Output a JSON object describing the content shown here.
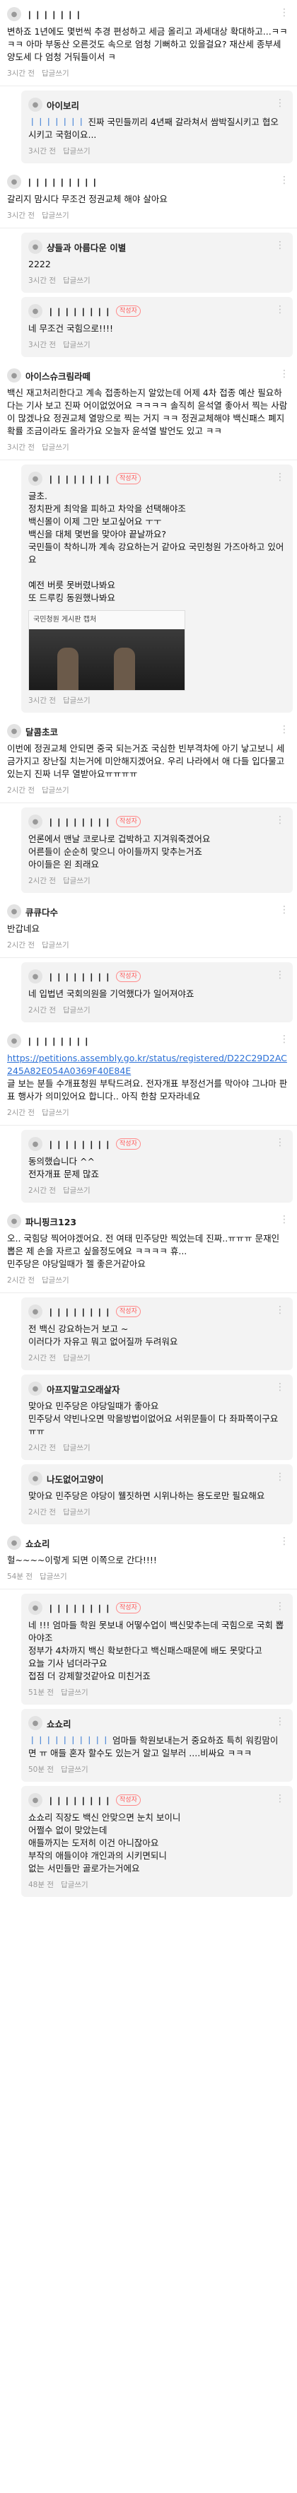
{
  "comments": [
    {
      "name": "ㅣㅣㅣㅣㅣㅣㅣ",
      "body": "변하죠 1년에도 몇번씩 추경 편성하고 세금 올리고 과세대상 확대하고...ㅋㅋㅋㅋ 아마 부동산 오른것도 속으로 엄청 기뻐하고 있을걸요? 재산세 종부세 양도세 다 엄청 거둬들이서 ㅋ",
      "time": "3시간 전",
      "reply_label": "답글쓰기"
    },
    {
      "name": "아이보리",
      "reply": true,
      "mention": "ㅣㅣㅣㅣㅣㅣㅣ",
      "body": "진짜 국민들끼리 4년째 갈라쳐서 쌈박질시키고 협오시키고 국험이요...",
      "time": "3시간 전",
      "reply_label": "답글쓰기"
    },
    {
      "name": "ㅣㅣㅣㅣㅣㅣㅣㅣㅣ",
      "body": "갈리지 맘시다 무조건 정권교체 해야 살아요",
      "time": "3시간 전",
      "reply_label": "답글쓰기"
    },
    {
      "name": "샹들과 아름다운 이별",
      "reply": true,
      "body": "2222",
      "time": "3시간 전",
      "reply_label": "답글쓰기"
    },
    {
      "name": "ㅣㅣㅣㅣㅣㅣㅣㅣ",
      "reply": true,
      "writer": true,
      "body": "네 무조건 국힘으로!!!!",
      "time": "3시간 전",
      "reply_label": "답글쓰기"
    },
    {
      "name": "아이스슈크림라떼",
      "body": "백신 재고처리한다고 계속 접종하는지 알았는데 어제 4차 접종 예산 필요하다는 기사 보고 진짜 어이없었어요 ㅋㅋㅋㅋ 솔직히 윤석열 좋아서 찍는 사람이 많겠나요 정권교체 열망으로 찍는 거지 ㅋㅋ 정권교체해야 백신패스 폐지 확률 조금이라도 올라가요 오늘자 윤석열 발언도 있고 ㅋㅋ",
      "time": "3시간 전",
      "reply_label": "답글쓰기"
    },
    {
      "name": "ㅣㅣㅣㅣㅣㅣㅣㅣ",
      "reply": true,
      "writer": true,
      "body": "글초.\n정치판게 최악을 피하고 차악을 선택해야조\n백신몰이 이제 그만 보고싶어요 ㅜㅜ\n백신을 대체 몇번을 맞아야 끝날까요?\n국민들이 착하니까 계속 강요하는거 같아요 국민청원 가즈아하고 있어요\n\n예전 버릇 못버렸나봐요\n또 드루킹 동원했나봐요",
      "image": true,
      "image_caption": "국민청원 게시판 캡처",
      "time": "3시간 전",
      "reply_label": "답글쓰기"
    },
    {
      "name": "달콤초코",
      "body": "이번에 정권교체 안되면 중국 되는거죠 국심한 빈부격차에 아기 낳고보니 세금가지고 장난질 치는거에 미안해지겠어요. 우리 나라에서 애 다들 입다물고 있는지 진짜 너무 열받아요ㅠㅠㅠㅠ",
      "time": "2시간 전",
      "reply_label": "답글쓰기"
    },
    {
      "name": "ㅣㅣㅣㅣㅣㅣㅣㅣ",
      "reply": true,
      "writer": true,
      "body": "언론에서 맨날 코로나로 겁박하고 지겨워죽겠어요\n어른들이 순순히 맞으니 아이들까지 맞추는거죠\n아이들은 왼 죄래요",
      "time": "2시간 전",
      "reply_label": "답글쓰기"
    },
    {
      "name": "큐큐다수",
      "body": "반갑네요",
      "time": "2시간 전",
      "reply_label": "답글쓰기"
    },
    {
      "name": "ㅣㅣㅣㅣㅣㅣㅣㅣ",
      "reply": true,
      "writer": true,
      "body": "네 입법년 국회의원을 기억했다가 일어져야죠",
      "time": "2시간 전",
      "reply_label": "답글쓰기"
    },
    {
      "name": "ㅣㅣㅣㅣㅣㅣㅣㅣ",
      "body_link": "https://petitions.assembly.go.kr/status/registered/D22C29D2AC245A82E054A0369F40E84E",
      "body": "글 보는 분들 수개표청원 부탁드려요. 전자개표 부정선거를 막아야 그나마 판표 행사가 의미있어요 합니다.. 아직 한참 모자라네요",
      "time": "2시간 전",
      "reply_label": "답글쓰기"
    },
    {
      "name": "ㅣㅣㅣㅣㅣㅣㅣㅣ",
      "reply": true,
      "writer": true,
      "body": "동의했습니다 ^^\n전자개표 문제 많죠",
      "time": "2시간 전",
      "reply_label": "답글쓰기"
    },
    {
      "name": "파니핑크123",
      "body": "오.. 국힘당 찍어야겠어요. 전 여태 민주당만 찍었는데 진짜..ㅠㅠㅠ 문재인 뽑은 제 손을 자르고 싶을정도에요 ㅋㅋㅋㅋ 휴...\n민주당은 야당일때가 젤 좋은거같아요",
      "time": "2시간 전",
      "reply_label": "답글쓰기"
    },
    {
      "name": "ㅣㅣㅣㅣㅣㅣㅣㅣ",
      "reply": true,
      "writer": true,
      "body": "전 백신 강요하는거 보고 ~\n이러다가 자유고 뭐고 없어질까 두려워요",
      "time": "2시간 전",
      "reply_label": "답글쓰기"
    },
    {
      "name": "아프지말고오래살자",
      "reply": true,
      "body": "맞아요 민주당은 야당일때가 좋아요\n민주당서 약빈나오면 막을방법이없어요 서위문들이 다 좌파쪽이구요ㅠㅠ",
      "time": "2시간 전",
      "reply_label": "답글쓰기"
    },
    {
      "name": "나도없어고양이",
      "reply": true,
      "body": "맞아요 민주당은 야당이 웰짓하면 시위나하는 용도로만 필요해요",
      "time": "2시간 전",
      "reply_label": "답글쓰기"
    },
    {
      "name": "쇼쇼리",
      "body": "헐~~~~이렇게 되면 이쪽으로 간다!!!!",
      "time": "54분 전",
      "reply_label": "답글쓰기"
    },
    {
      "name": "ㅣㅣㅣㅣㅣㅣㅣㅣ",
      "reply": true,
      "writer": true,
      "body": "네 !!! 엄마들 학원 못보내 어떻수업이 백신맞추는데 국힘으로 국회 뽑아야조\n정부가 4차까지 백신 확보한다고 백신패스때문에 배도 못맞다고\n요늘 기사 넘더라구요\n접점 더 강제할것같아요 미친거죠",
      "time": "51분 전",
      "reply_label": "답글쓰기"
    },
    {
      "name": "쇼쇼리",
      "reply": true,
      "mention": "ㅣㅣㅣㅣㅣㅣㅣㅣㅣㅣ",
      "body": "엄마들 학원보내는거 중요하죠 특히 워킹맘이면 ㅠ 애들 혼자 할수도 있는거 알고 일부러 ....비싸요 ㅋㅋㅋ",
      "time": "50분 전",
      "reply_label": "답글쓰기"
    },
    {
      "name": "ㅣㅣㅣㅣㅣㅣㅣㅣ",
      "reply": true,
      "writer": true,
      "body": "쇼쇼리 직장도 백신 안맞으면 눈치 보이니\n어쩔수 없이 맞았는데\n애들까지는 도저히 이건 아니잖아요\n부작의 애들이야 개인과의 시키면되니\n없는 서민들만 골로가는거에요",
      "time": "48분 전",
      "reply_label": "답글쓰기"
    }
  ],
  "labels": {
    "writer_badge": "작성자",
    "more_icon": "⋮"
  },
  "colors": {
    "writer_badge": "#ff5a5a",
    "link": "#2a6fd6",
    "reply_bg": "#f3f3f3"
  }
}
